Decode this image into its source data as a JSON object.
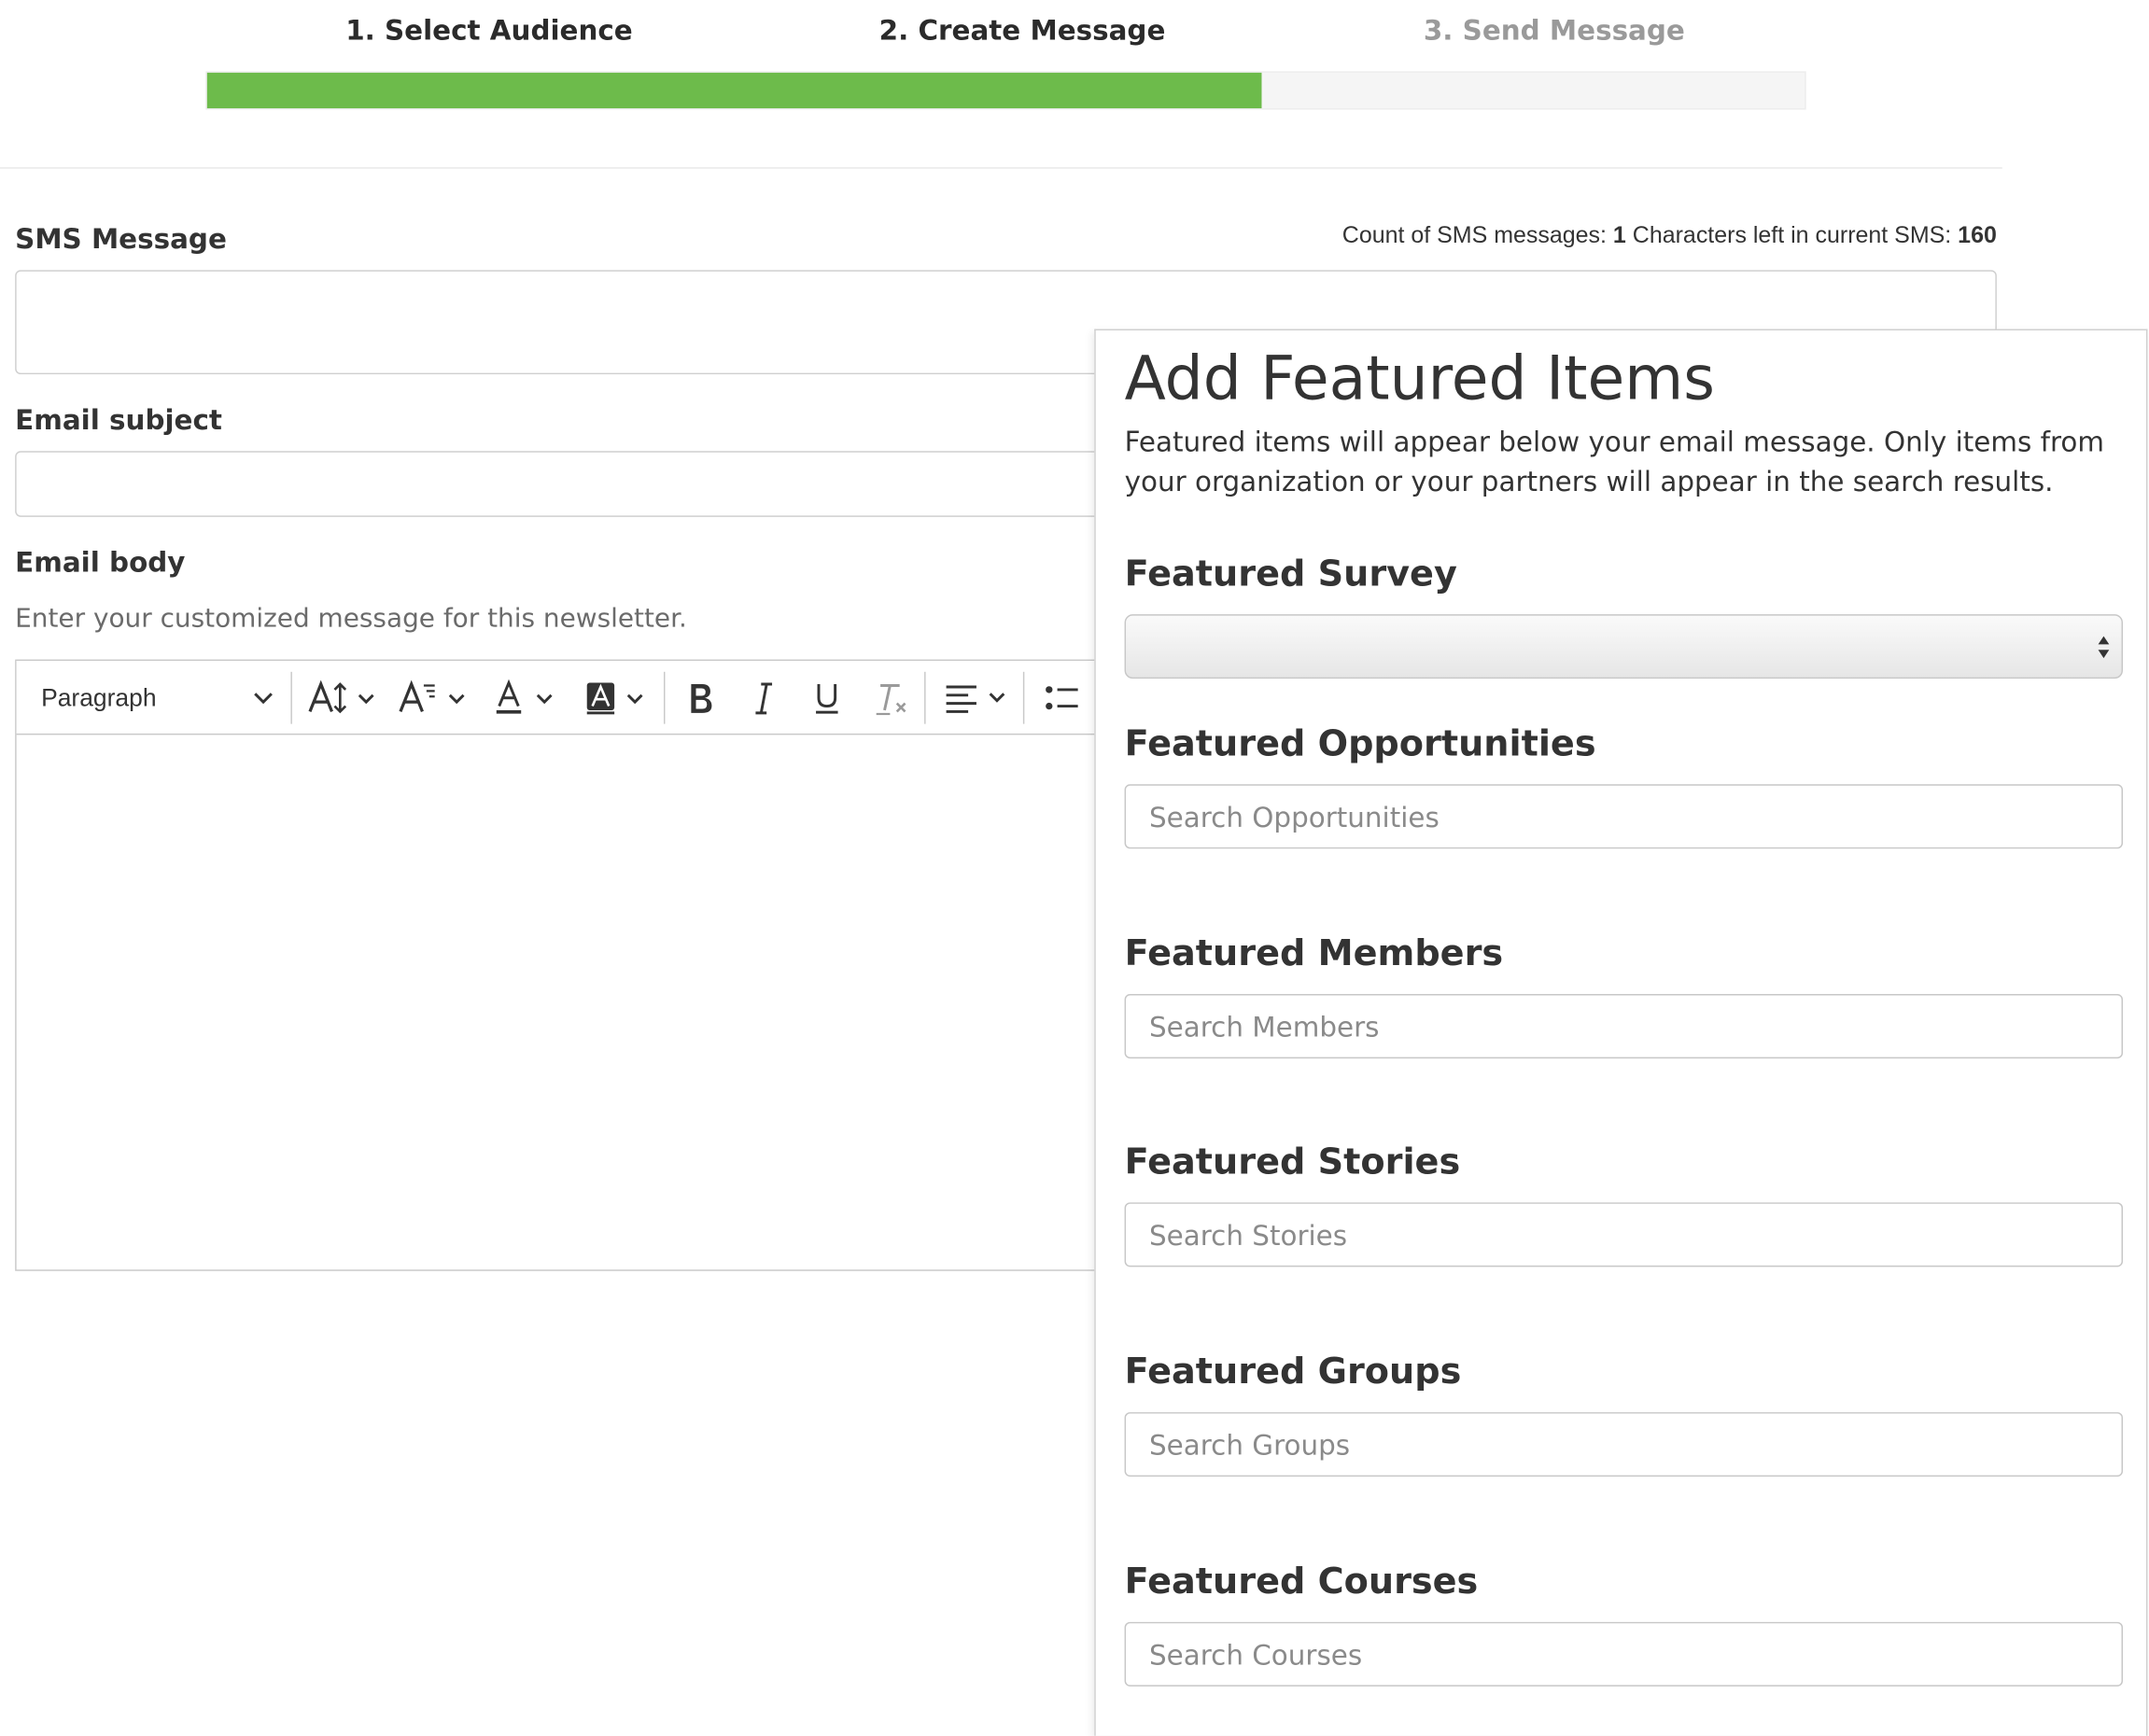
{
  "steps": [
    {
      "label": "1. Select Audience",
      "state": "complete"
    },
    {
      "label": "2. Create Message",
      "state": "current"
    },
    {
      "label": "3. Send Message",
      "state": "pending"
    }
  ],
  "progress": {
    "fraction": 0.66,
    "fill_color": "#6dbb4b"
  },
  "sms": {
    "label": "SMS Message",
    "count_label": "Count of SMS messages:",
    "count_value": "1",
    "chars_label": "Characters left in current SMS:",
    "chars_value": "160",
    "value": ""
  },
  "email_subject": {
    "label": "Email subject",
    "value": ""
  },
  "email_body": {
    "label": "Email body",
    "helper": "Enter your customized message for this newsletter.",
    "toolbar": {
      "paragraph": "Paragraph",
      "icons": [
        "font-size-icon",
        "font-family-icon",
        "font-color-icon",
        "highlight-color-icon",
        "bold-icon",
        "italic-icon",
        "underline-icon",
        "remove-format-icon",
        "align-icon",
        "bulleted-list-icon"
      ]
    }
  },
  "panel": {
    "title": "Add Featured Items",
    "description": "Featured items will appear below your email message. Only items from your organization or your partners will appear in the search results.",
    "survey": {
      "label": "Featured Survey",
      "value": ""
    },
    "sections": [
      {
        "key": "opportunities",
        "label": "Featured Opportunities",
        "placeholder": "Search Opportunities"
      },
      {
        "key": "members",
        "label": "Featured Members",
        "placeholder": "Search Members"
      },
      {
        "key": "stories",
        "label": "Featured Stories",
        "placeholder": "Search Stories"
      },
      {
        "key": "groups",
        "label": "Featured Groups",
        "placeholder": "Search Groups"
      },
      {
        "key": "courses",
        "label": "Featured Courses",
        "placeholder": "Search Courses"
      }
    ]
  }
}
